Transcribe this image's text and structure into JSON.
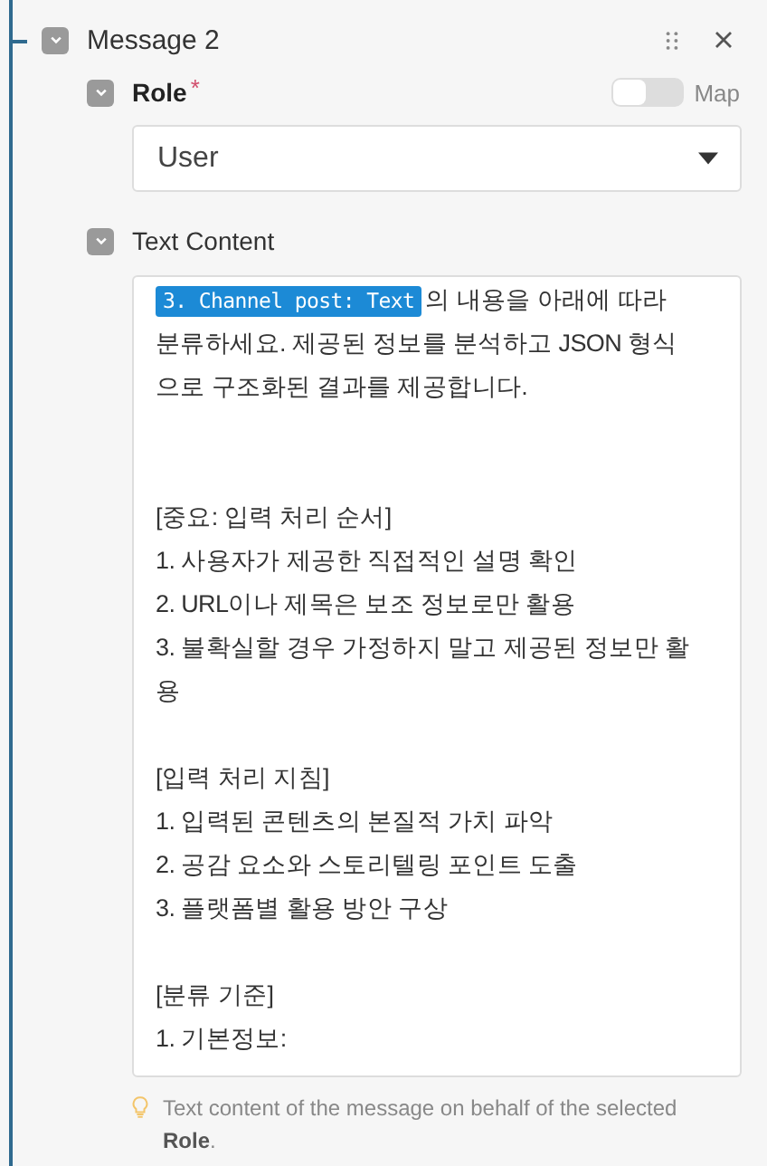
{
  "message": {
    "title": "Message 2",
    "expanded": true,
    "role": {
      "label": "Role",
      "required_mark": "*",
      "expanded": true,
      "map_label": "Map",
      "map_on": false,
      "value": "User"
    },
    "text_content": {
      "label": "Text Content",
      "expanded": true,
      "token": "3. Channel post: Text",
      "paragraphs": [
        [
          "의 내용을 아래에 따라",
          "분류하세요. 제공된 정보를 분석하고 JSON 형식",
          "으로 구조화된 결과를 제공합니다."
        ],
        [
          "[중요: 입력 처리 순서]",
          "1. 사용자가 제공한 직접적인 설명 확인",
          "2. URL이나 제목은 보조 정보로만 활용",
          "3. 불확실할 경우 가정하지 말고 제공된 정보만 활",
          "용"
        ],
        [
          "[입력 처리 지침]",
          "1. 입력된 콘텐츠의 본질적 가치 파악",
          "2. 공감 요소와 스토리텔링 포인트 도출",
          "3. 플랫폼별 활용 방안 구상"
        ],
        [
          "[분류 기준]",
          "1. 기본정보:"
        ]
      ],
      "hint": "Text content of the message on behalf of the selected **Role**."
    }
  }
}
